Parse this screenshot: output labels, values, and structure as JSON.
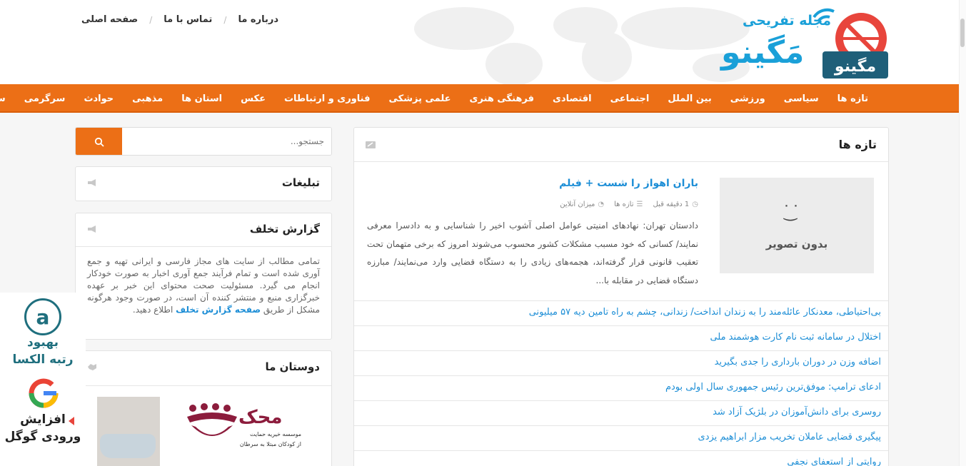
{
  "header": {
    "top_links": [
      "صفحه اصلی",
      "تماس با ما",
      "درباره ما"
    ],
    "logo_tagline": "مجله تفریحی",
    "logo_name": "مَگینو",
    "logo_badge": "مگینو"
  },
  "nav": {
    "items": [
      "تازه ها",
      "سیاسی",
      "ورزشی",
      "بین الملل",
      "اجتماعی",
      "اقتصادی",
      "فرهنگی هنری",
      "علمی پزشکی",
      "فناوری و ارتباطات",
      "عکس",
      "استان ها",
      "مذهبی",
      "حوادث",
      "سرگرمی",
      "سینما"
    ]
  },
  "main": {
    "title": "تازه ها",
    "featured": {
      "image_placeholder_text": "بدون تصویر",
      "title": "باران اهواز را شست + فیلم",
      "time": "1 دقیقه قبل",
      "category": "تازه ها",
      "source": "میزان آنلاین",
      "excerpt": "دادستان تهران: نهادهای امنیتی عوامل اصلی آشوب اخیر را شناسایی و به دادسرا معرفی نمایند/ کسانی که خود مسبب مشکلات کشور محسوب می‌شوند امروز که برخی متهمان تحت تعقیب قانونی قرار گرفته‌اند، هجمه‌های زیادی را به دستگاه قضایی وارد می‌نمایند/ مبارزه دستگاه قضایی در مقابله با..."
    },
    "list": [
      "بی‌احتیاطی، معدنکار عائله‌مند را به زندان انداخت/ زندانی، چشم به راه تامین دیه ۵۷ میلیونی",
      "اختلال در سامانه ثبت نام کارت هوشمند ملی",
      "اضافه وزن در دوران بارداری را جدی بگیرید",
      "ادعای ترامپ: موفق‌ترین رئیس جمهوری سال اولی بودم",
      "روسری برای دانش‌آموزان در بلژیک آزاد شد",
      "پیگیری قضایی عاملان تخریب مزار ابراهیم یزدی",
      "روایتی از استعفای نجفی"
    ]
  },
  "sidebar": {
    "search_placeholder": "جستجو...",
    "ads_title": "تبلیغات",
    "report_title": "گزارش تخلف",
    "report_text": "تمامی مطالب از سایت های مجاز فارسی و ایرانی تهیه و جمع آوری شده است و تمام فرآیند جمع آوری اخبار به صورت خودکار انجام می گیرد. مسئولیت صحت محتوای این خبر بر عهده خبرگزاری منبع و منتشر کننده آن است، در صورت وجود هرگونه مشکل از طریق",
    "report_link": "صفحه گزارش تخلف",
    "report_tail": "اطلاع دهید.",
    "friends_title": "دوستان ما",
    "ad_brand": "محک",
    "ad_sub1": "موسسه خیریه حمایت",
    "ad_sub2": "از کودکان مبتلا به سرطان"
  },
  "floating": {
    "alexa_line1": "بهبود",
    "alexa_line2": "رتبه الکسا",
    "google_line1": "افزایش",
    "google_line2": "ورودی گوگل"
  },
  "colors": {
    "accent": "#ec6f16",
    "link": "#1d8ed6",
    "brand_blue": "#1aa0d8"
  }
}
